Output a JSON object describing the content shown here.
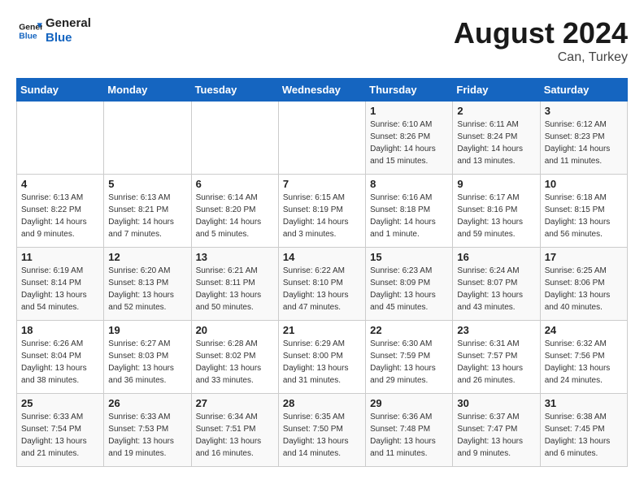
{
  "header": {
    "logo_line1": "General",
    "logo_line2": "Blue",
    "month_year": "August 2024",
    "location": "Can, Turkey"
  },
  "weekdays": [
    "Sunday",
    "Monday",
    "Tuesday",
    "Wednesday",
    "Thursday",
    "Friday",
    "Saturday"
  ],
  "weeks": [
    [
      {
        "day": "",
        "info": ""
      },
      {
        "day": "",
        "info": ""
      },
      {
        "day": "",
        "info": ""
      },
      {
        "day": "",
        "info": ""
      },
      {
        "day": "1",
        "info": "Sunrise: 6:10 AM\nSunset: 8:26 PM\nDaylight: 14 hours\nand 15 minutes."
      },
      {
        "day": "2",
        "info": "Sunrise: 6:11 AM\nSunset: 8:24 PM\nDaylight: 14 hours\nand 13 minutes."
      },
      {
        "day": "3",
        "info": "Sunrise: 6:12 AM\nSunset: 8:23 PM\nDaylight: 14 hours\nand 11 minutes."
      }
    ],
    [
      {
        "day": "4",
        "info": "Sunrise: 6:13 AM\nSunset: 8:22 PM\nDaylight: 14 hours\nand 9 minutes."
      },
      {
        "day": "5",
        "info": "Sunrise: 6:13 AM\nSunset: 8:21 PM\nDaylight: 14 hours\nand 7 minutes."
      },
      {
        "day": "6",
        "info": "Sunrise: 6:14 AM\nSunset: 8:20 PM\nDaylight: 14 hours\nand 5 minutes."
      },
      {
        "day": "7",
        "info": "Sunrise: 6:15 AM\nSunset: 8:19 PM\nDaylight: 14 hours\nand 3 minutes."
      },
      {
        "day": "8",
        "info": "Sunrise: 6:16 AM\nSunset: 8:18 PM\nDaylight: 14 hours\nand 1 minute."
      },
      {
        "day": "9",
        "info": "Sunrise: 6:17 AM\nSunset: 8:16 PM\nDaylight: 13 hours\nand 59 minutes."
      },
      {
        "day": "10",
        "info": "Sunrise: 6:18 AM\nSunset: 8:15 PM\nDaylight: 13 hours\nand 56 minutes."
      }
    ],
    [
      {
        "day": "11",
        "info": "Sunrise: 6:19 AM\nSunset: 8:14 PM\nDaylight: 13 hours\nand 54 minutes."
      },
      {
        "day": "12",
        "info": "Sunrise: 6:20 AM\nSunset: 8:13 PM\nDaylight: 13 hours\nand 52 minutes."
      },
      {
        "day": "13",
        "info": "Sunrise: 6:21 AM\nSunset: 8:11 PM\nDaylight: 13 hours\nand 50 minutes."
      },
      {
        "day": "14",
        "info": "Sunrise: 6:22 AM\nSunset: 8:10 PM\nDaylight: 13 hours\nand 47 minutes."
      },
      {
        "day": "15",
        "info": "Sunrise: 6:23 AM\nSunset: 8:09 PM\nDaylight: 13 hours\nand 45 minutes."
      },
      {
        "day": "16",
        "info": "Sunrise: 6:24 AM\nSunset: 8:07 PM\nDaylight: 13 hours\nand 43 minutes."
      },
      {
        "day": "17",
        "info": "Sunrise: 6:25 AM\nSunset: 8:06 PM\nDaylight: 13 hours\nand 40 minutes."
      }
    ],
    [
      {
        "day": "18",
        "info": "Sunrise: 6:26 AM\nSunset: 8:04 PM\nDaylight: 13 hours\nand 38 minutes."
      },
      {
        "day": "19",
        "info": "Sunrise: 6:27 AM\nSunset: 8:03 PM\nDaylight: 13 hours\nand 36 minutes."
      },
      {
        "day": "20",
        "info": "Sunrise: 6:28 AM\nSunset: 8:02 PM\nDaylight: 13 hours\nand 33 minutes."
      },
      {
        "day": "21",
        "info": "Sunrise: 6:29 AM\nSunset: 8:00 PM\nDaylight: 13 hours\nand 31 minutes."
      },
      {
        "day": "22",
        "info": "Sunrise: 6:30 AM\nSunset: 7:59 PM\nDaylight: 13 hours\nand 29 minutes."
      },
      {
        "day": "23",
        "info": "Sunrise: 6:31 AM\nSunset: 7:57 PM\nDaylight: 13 hours\nand 26 minutes."
      },
      {
        "day": "24",
        "info": "Sunrise: 6:32 AM\nSunset: 7:56 PM\nDaylight: 13 hours\nand 24 minutes."
      }
    ],
    [
      {
        "day": "25",
        "info": "Sunrise: 6:33 AM\nSunset: 7:54 PM\nDaylight: 13 hours\nand 21 minutes."
      },
      {
        "day": "26",
        "info": "Sunrise: 6:33 AM\nSunset: 7:53 PM\nDaylight: 13 hours\nand 19 minutes."
      },
      {
        "day": "27",
        "info": "Sunrise: 6:34 AM\nSunset: 7:51 PM\nDaylight: 13 hours\nand 16 minutes."
      },
      {
        "day": "28",
        "info": "Sunrise: 6:35 AM\nSunset: 7:50 PM\nDaylight: 13 hours\nand 14 minutes."
      },
      {
        "day": "29",
        "info": "Sunrise: 6:36 AM\nSunset: 7:48 PM\nDaylight: 13 hours\nand 11 minutes."
      },
      {
        "day": "30",
        "info": "Sunrise: 6:37 AM\nSunset: 7:47 PM\nDaylight: 13 hours\nand 9 minutes."
      },
      {
        "day": "31",
        "info": "Sunrise: 6:38 AM\nSunset: 7:45 PM\nDaylight: 13 hours\nand 6 minutes."
      }
    ]
  ]
}
